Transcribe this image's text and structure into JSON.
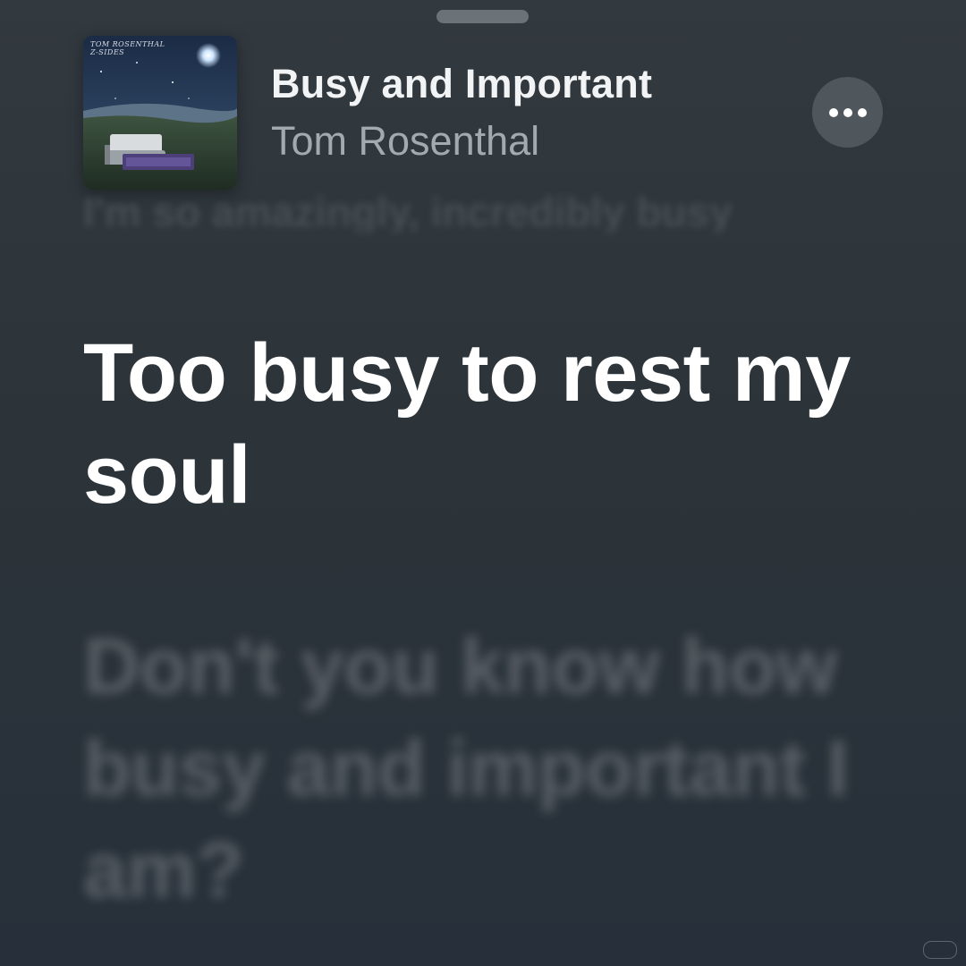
{
  "now_playing": {
    "title": "Busy and Important",
    "artist": "Tom Rosenthal",
    "artwork_caption": "TOM ROSENTHAL\nZ-SIDES",
    "more_icon": "ellipsis-icon"
  },
  "lyrics": {
    "previous_line": "I'm so amazingly, incredibly busy",
    "current_line": "Too busy to rest my soul",
    "next_line": "Don't you know how busy and important I am?"
  },
  "colors": {
    "background": "#2e363b",
    "active_lyric": "#ffffff",
    "artist_text": "#a4a9ad",
    "more_button_bg": "#4f575c"
  }
}
